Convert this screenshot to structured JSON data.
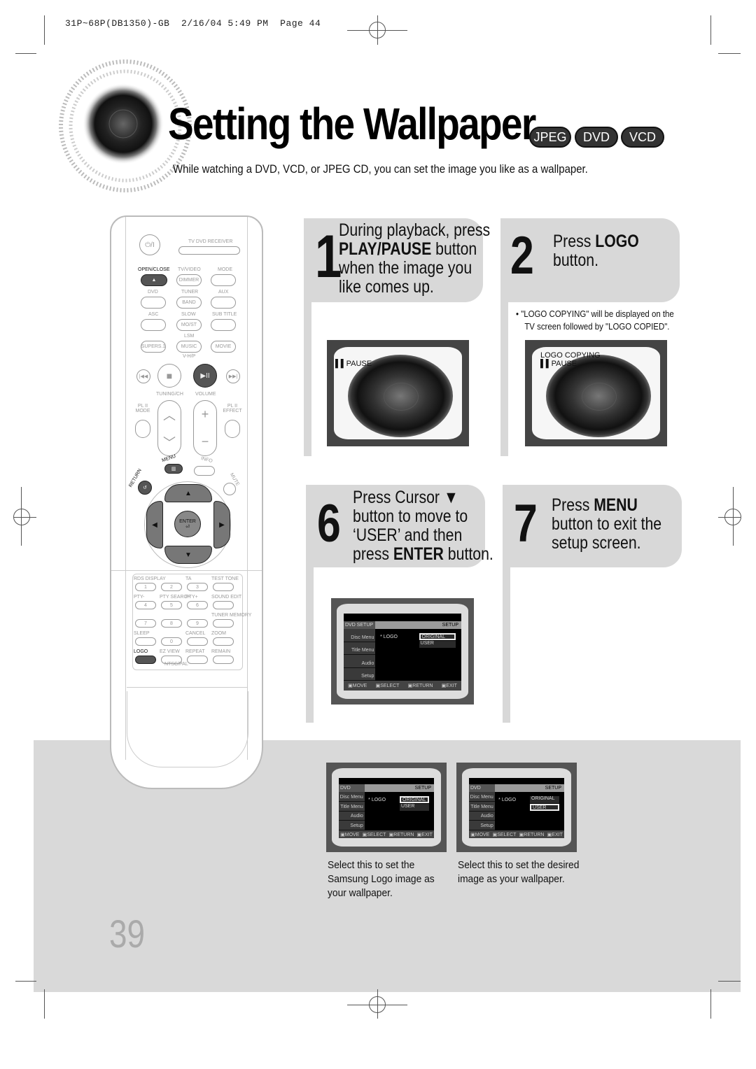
{
  "print_header": "31P~68P(DB1350)-GB  2/16/04 5:49 PM  Page 44",
  "title": "Setting the Wallpaper",
  "badges": [
    "JPEG",
    "DVD",
    "VCD"
  ],
  "subtitle": "While watching a DVD, VCD, or JPEG CD, you can set the image you like as a wallpaper.",
  "steps": [
    {
      "number": "1",
      "lines": [
        {
          "pre": "During playback, press",
          "bold": "",
          "post": ""
        },
        {
          "pre": "",
          "bold": "PLAY/PAUSE",
          "post": " button"
        },
        {
          "pre": "when the image you",
          "bold": "",
          "post": ""
        },
        {
          "pre": "like comes up.",
          "bold": "",
          "post": ""
        }
      ],
      "screen": {
        "osd": [
          "▌▌PAUSE"
        ]
      }
    },
    {
      "number": "2",
      "lines": [
        {
          "pre": "Press ",
          "bold": "LOGO",
          "post": ""
        },
        {
          "pre": "button.",
          "bold": "",
          "post": ""
        }
      ],
      "note": [
        "\"LOGO COPYING\" will be displayed on the",
        "TV screen followed by \"LOGO COPIED\"."
      ],
      "screen": {
        "osd": [
          "LOGO COPYING",
          "▌▌PAUSE"
        ]
      }
    },
    {
      "number": "6",
      "lines": [
        {
          "pre": "Press Cursor ▼",
          "bold": "",
          "post": ""
        },
        {
          "pre": "button to move to",
          "bold": "",
          "post": ""
        },
        {
          "pre": "‘USER’ and then",
          "bold": "",
          "post": ""
        },
        {
          "pre": "press ",
          "bold": "ENTER",
          "post": " button."
        }
      ]
    },
    {
      "number": "7",
      "lines": [
        {
          "pre": "Press ",
          "bold": "MENU",
          "post": ""
        },
        {
          "pre": "button to exit the",
          "bold": "",
          "post": ""
        },
        {
          "pre": "setup screen.",
          "bold": "",
          "post": ""
        }
      ]
    }
  ],
  "setup_menu": {
    "header_left": "DVD SETUP",
    "header_right": "SETUP",
    "side_items": [
      "Disc Menu",
      "Title Menu",
      "Audio",
      "Setup"
    ],
    "logo_label": "* LOGO",
    "options": [
      "ORIGINAL",
      "USER"
    ],
    "footer": [
      "MOVE",
      "SELECT",
      "RETURN",
      "EXIT"
    ]
  },
  "options_panel": [
    {
      "selected_option": "ORIGINAL",
      "caption": [
        "Select this to set the",
        "Samsung Logo image as",
        "your wallpaper."
      ]
    },
    {
      "selected_option": "USER",
      "caption": [
        "Select this to set the desired",
        "image as your wallpaper."
      ]
    }
  ],
  "page_number": "39",
  "remote": {
    "power": "⏻/I",
    "tv_dvd": "TV   DVD RECEIVER",
    "rows": [
      [
        "OPEN/CLOSE",
        "TV/VIDEO",
        "MODE"
      ],
      [
        "DVD",
        "TUNER",
        "AUX"
      ],
      [
        "ASC",
        "SLOW",
        "SUB TITLE"
      ],
      [
        "SUPERS.1",
        "MUSIC",
        "MOVIE"
      ]
    ],
    "sublabels": [
      "DIMMER",
      "BAND",
      "MO/ST"
    ],
    "lsm": "LSM",
    "vhp": "V-H/P",
    "transport": [
      "|◀◀",
      "■",
      "▶II",
      "▶▶|"
    ],
    "tuning": "TUNING/CH",
    "volume": "VOLUME",
    "pl_mode": "PL II MODE",
    "pl_effect": "PL II EFFECT",
    "menu": "MENU",
    "info": "INFO",
    "return": "RETURN",
    "mute": "MUTE",
    "enter": "ENTER",
    "keypad": [
      {
        "label": "RDS DISPLAY",
        "key": "1"
      },
      {
        "label": "",
        "key": "2"
      },
      {
        "label": "TA",
        "key": "3"
      },
      {
        "label": "TEST TONE",
        "key": ""
      },
      {
        "label": "PTY-",
        "key": "4"
      },
      {
        "label": "PTY SEARCH",
        "key": "5"
      },
      {
        "label": "PTY+",
        "key": "6"
      },
      {
        "label": "SOUND EDIT",
        "key": ""
      },
      {
        "label": "",
        "key": "7"
      },
      {
        "label": "",
        "key": "8"
      },
      {
        "label": "",
        "key": "9"
      },
      {
        "label": "TUNER MEMORY",
        "key": ""
      },
      {
        "label": "SLEEP",
        "key": ""
      },
      {
        "label": "",
        "key": "0"
      },
      {
        "label": "CANCEL",
        "key": ""
      },
      {
        "label": "ZOOM",
        "key": ""
      },
      {
        "label": "LOGO",
        "key": ""
      },
      {
        "label": "EZ VIEW",
        "key": ""
      },
      {
        "label": "REPEAT",
        "key": ""
      },
      {
        "label": "REMAIN",
        "key": ""
      }
    ],
    "ntsc": "NTSC/PAL"
  }
}
